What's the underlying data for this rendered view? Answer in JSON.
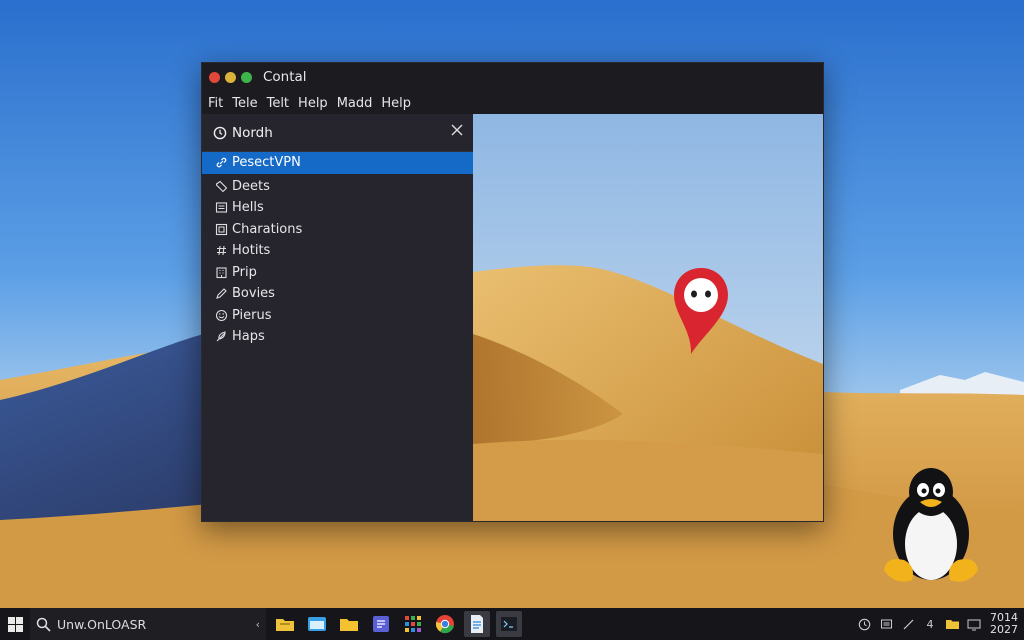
{
  "window": {
    "title": "Contal",
    "menu": [
      "Fit",
      "Tele",
      "Telt",
      "Help",
      "Madd",
      "Help"
    ]
  },
  "sidebar": {
    "search_label": "Nordh",
    "items": [
      {
        "label": "PesectVPN",
        "icon": "link-icon",
        "active": true
      },
      {
        "label": "Deets",
        "icon": "tag-icon"
      },
      {
        "label": "Hells",
        "icon": "list-icon"
      },
      {
        "label": "Charations",
        "icon": "box-icon"
      },
      {
        "label": "Hotits",
        "icon": "hash-icon"
      },
      {
        "label": "Prip",
        "icon": "building-icon"
      },
      {
        "label": "Bovies",
        "icon": "pen-icon"
      },
      {
        "label": "Pierus",
        "icon": "smile-icon"
      },
      {
        "label": "Haps",
        "icon": "feather-icon"
      }
    ]
  },
  "taskbar": {
    "search_text": "Unw.OnLOASR",
    "chevron": "‹",
    "clock_top": "7014",
    "clock_bottom": "2027",
    "tray_number": "4"
  },
  "colors": {
    "accent": "#1569c7",
    "pin": "#d9252f",
    "window_bg": "#1f1f24",
    "sidebar_bg": "#26252e"
  }
}
